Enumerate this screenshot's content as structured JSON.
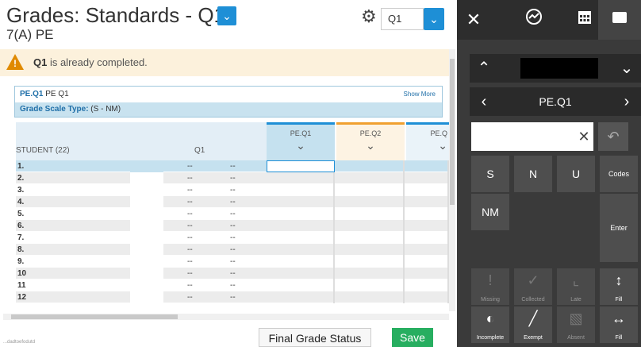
{
  "header": {
    "title": "Grades: Standards - Q1",
    "subtitle": "7(A) PE",
    "term_value": "Q1"
  },
  "alert": {
    "term": "Q1",
    "message": " is already completed."
  },
  "info": {
    "code": "PE.Q1",
    "code_desc": " PE Q1",
    "show_more": "Show More",
    "scale_label": "Grade Scale Type:",
    "scale_value": " (S - NM)"
  },
  "grid": {
    "student_header": "STUDENT (22)",
    "term_header": "Q1",
    "columns": [
      {
        "label": "PE.Q1",
        "color": "#1e8fd6"
      },
      {
        "label": "PE.Q2",
        "color": "#f0a030"
      },
      {
        "label": "PE.Q",
        "color": "#1e8fd6"
      }
    ],
    "rows": [
      "1.",
      "2.",
      "3.",
      "4.",
      "5.",
      "6.",
      "7.",
      "8.",
      "9.",
      "10",
      "11",
      "12"
    ],
    "empty_value": "--"
  },
  "footer": {
    "final_grade_label": "Final Grade Status",
    "save_label": "Save",
    "footnote": "...dadtoefodutd"
  },
  "keypad": {
    "nav_label": "PE.Q1",
    "keys": {
      "s": "S",
      "n": "N",
      "u": "U",
      "codes": "Codes",
      "nm": "NM",
      "enter": "Enter"
    },
    "flags": {
      "missing": "Missing",
      "collected": "Collected",
      "late": "Late",
      "fill_down": "Fill",
      "incomplete": "Incomplete",
      "exempt": "Exempt",
      "absent": "Absent",
      "fill_across": "Fill"
    }
  },
  "colors": {
    "accent": "#1e8fd6",
    "save": "#27ae60",
    "panel": "#3a3a3a"
  }
}
